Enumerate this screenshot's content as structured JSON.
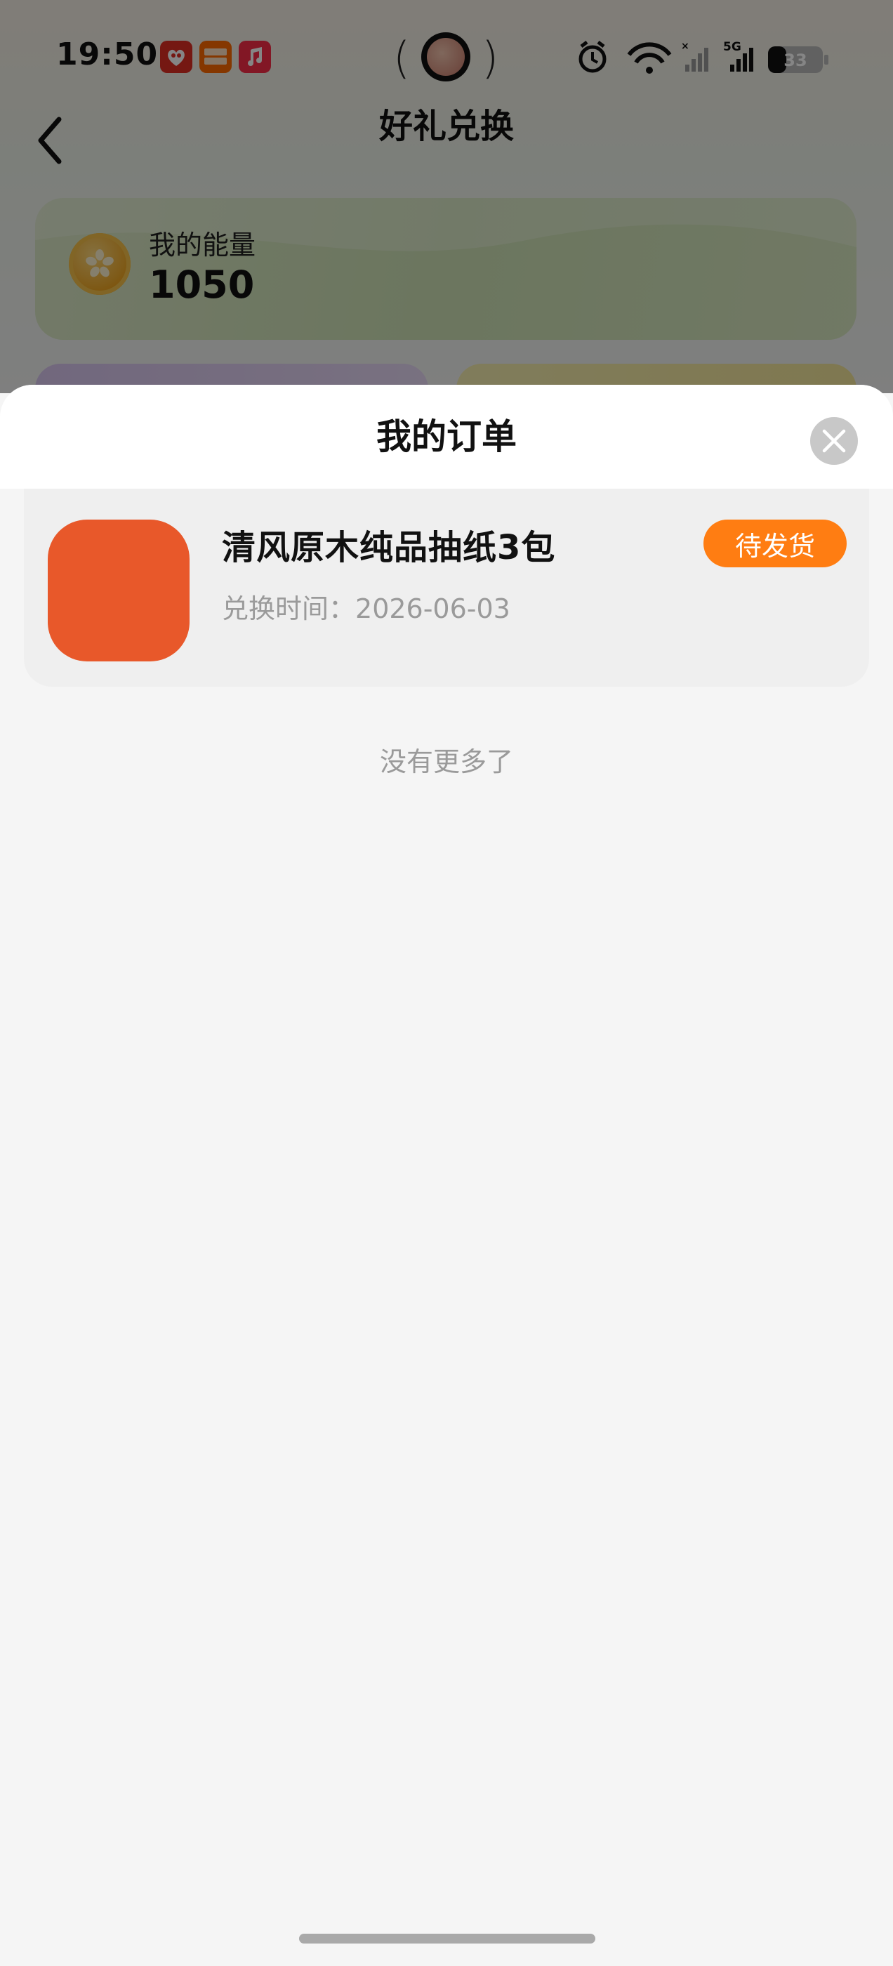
{
  "status_bar": {
    "time": "19:50",
    "app_icons": [
      {
        "name": "pinduoduo-icon",
        "color": "#e02e24",
        "label": "618"
      },
      {
        "name": "taobao-flash-icon",
        "color": "#ff6a00",
        "label": "淘宝\n闪购"
      },
      {
        "name": "music-icon",
        "color": "#fa2d48",
        "label": "♪"
      }
    ],
    "battery": "33",
    "network": "5G"
  },
  "header": {
    "title": "好礼兑换"
  },
  "energy": {
    "label": "我的能量",
    "value": "1050"
  },
  "sheet": {
    "title": "我的订单"
  },
  "orders": [
    {
      "name": "清风原木纯品抽纸3包",
      "time_label": "兑换时间：",
      "time": "2026-06-03",
      "status": "待发货",
      "thumb_color": "#e8582a"
    }
  ],
  "footer": {
    "no_more": "没有更多了"
  },
  "colors": {
    "status_badge": "#ff7d12",
    "energy_card": "#cfe3b6"
  }
}
